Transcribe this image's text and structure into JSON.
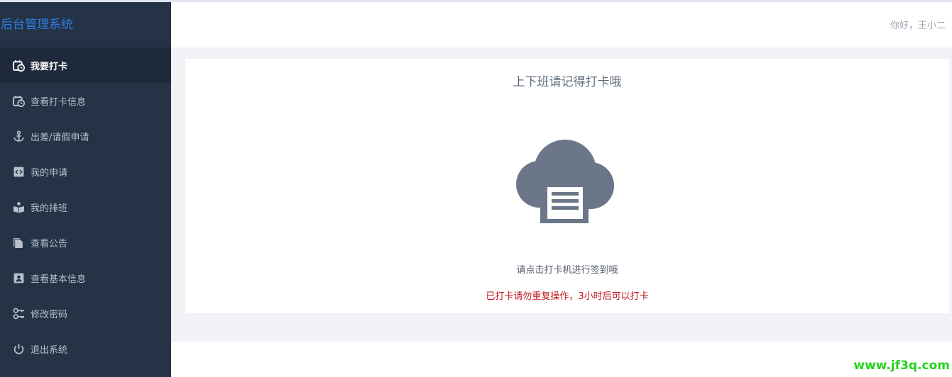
{
  "brand": {
    "title": "后台管理系统"
  },
  "sidebar": {
    "items": [
      {
        "label": "我要打卡",
        "icon": "calendar-clock-icon",
        "active": true
      },
      {
        "label": "查看打卡信息",
        "icon": "calendar-clock-icon",
        "active": false
      },
      {
        "label": "出差/请假申请",
        "icon": "anchor-icon",
        "active": false
      },
      {
        "label": "我的申请",
        "icon": "code-square-icon",
        "active": false
      },
      {
        "label": "我的排班",
        "icon": "reader-icon",
        "active": false
      },
      {
        "label": "查看公告",
        "icon": "copy-document-icon",
        "active": false
      },
      {
        "label": "查看基本信息",
        "icon": "contact-card-icon",
        "active": false
      },
      {
        "label": "修改密码",
        "icon": "key-icon",
        "active": false
      },
      {
        "label": "退出系统",
        "icon": "power-icon",
        "active": false
      }
    ]
  },
  "header": {
    "greeting": "你好，王小二"
  },
  "card": {
    "title": "上下班请记得打卡哦",
    "machine_icon": "cloud-document-icon",
    "hint": "请点击打卡机进行签到哦",
    "warning": "已打卡请勿重复操作，3小时后可以打卡"
  },
  "watermark": {
    "text": "www.jf3q.com"
  },
  "colors": {
    "sidebar_bg": "#253347",
    "sidebar_active_bg": "#1e2a3b",
    "brand": "#2f7de1",
    "main_bg": "#f0f2f5",
    "icon_gray": "#6b7789",
    "warning": "#c0151a",
    "watermark": "#27d21d"
  }
}
